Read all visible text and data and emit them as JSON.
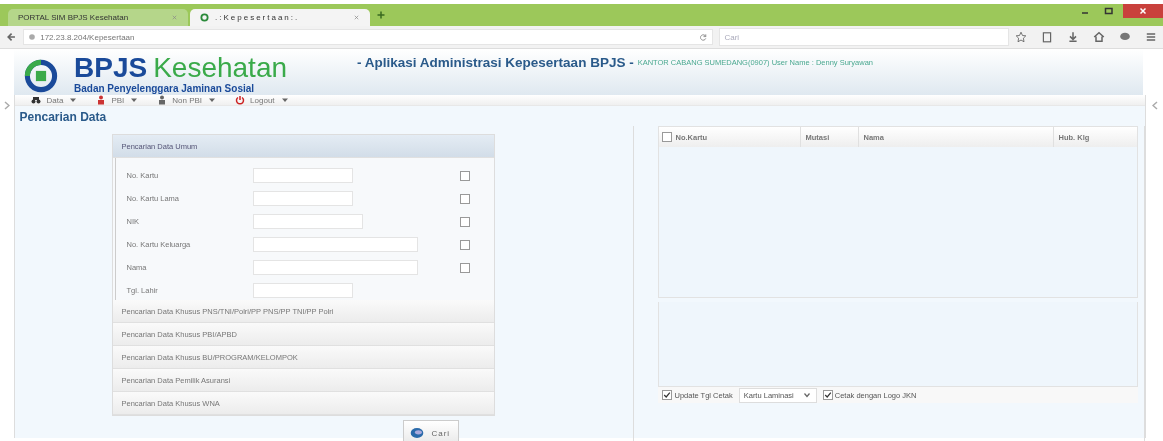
{
  "browser": {
    "tabs": [
      {
        "label": "PORTAL SIM BPJS Kesehatan",
        "selected": false
      },
      {
        "label": ".:Kepesertaan:.",
        "selected": true
      }
    ],
    "url": "172.23.8.204/Kepesertaan",
    "search_placeholder": "Cari"
  },
  "header": {
    "brand_primary": "BPJS",
    "brand_secondary": "Kesehatan",
    "tagline": "Badan Penyelenggara Jaminan Sosial",
    "app_title": "- Aplikasi Administrasi Kepesertaan BPJS -",
    "user_info": "KANTOR CABANG SUMEDANG(0907) User Name : Denny Suryawan"
  },
  "menu": [
    {
      "label": "Data",
      "kind": "binoculars"
    },
    {
      "label": "PBI",
      "kind": "person-red"
    },
    {
      "label": "Non PBI",
      "kind": "person-grey"
    },
    {
      "label": "Logout",
      "kind": "power"
    }
  ],
  "page_title": "Pencarian Data",
  "search_panel": {
    "sections": [
      {
        "title": "Pencarian Data Umum",
        "expanded": true,
        "fields": [
          {
            "label": "No. Kartu",
            "kind": "short",
            "checked": false
          },
          {
            "label": "No. Kartu Lama",
            "kind": "short",
            "checked": false
          },
          {
            "label": "NIK",
            "kind": "medium",
            "checked": false
          },
          {
            "label": "No. Kartu Keluarga",
            "kind": "wide",
            "checked": false
          },
          {
            "label": "Nama",
            "kind": "wide",
            "checked": false
          },
          {
            "label": "Tgl. Lahir",
            "kind": "short"
          }
        ]
      },
      {
        "title": "Pencarian Data Khusus PNS/TNI/Polri/PP PNS/PP TNI/PP Polri",
        "expanded": false
      },
      {
        "title": "Pencarian Data Khusus PBI/APBD",
        "expanded": false
      },
      {
        "title": "Pencarian Data Khusus BU/PROGRAM/KELOMPOK",
        "expanded": false
      },
      {
        "title": "Pencarian Data Pemilik Asuransi",
        "expanded": false
      },
      {
        "title": "Pencarian Data Khusus WNA",
        "expanded": false
      }
    ],
    "button": "Cari"
  },
  "results": {
    "select_all": false,
    "columns": [
      "No.Kartu",
      "Mutasi",
      "Nama",
      "Hub. Klg"
    ],
    "options": [
      {
        "kind": "checkbox",
        "label": "Update Tgl Cetak",
        "checked": true
      },
      {
        "kind": "select",
        "value": "Kartu Laminasi"
      },
      {
        "kind": "checkbox",
        "label": "Cetak dengan Logo JKN",
        "checked": true
      }
    ]
  }
}
